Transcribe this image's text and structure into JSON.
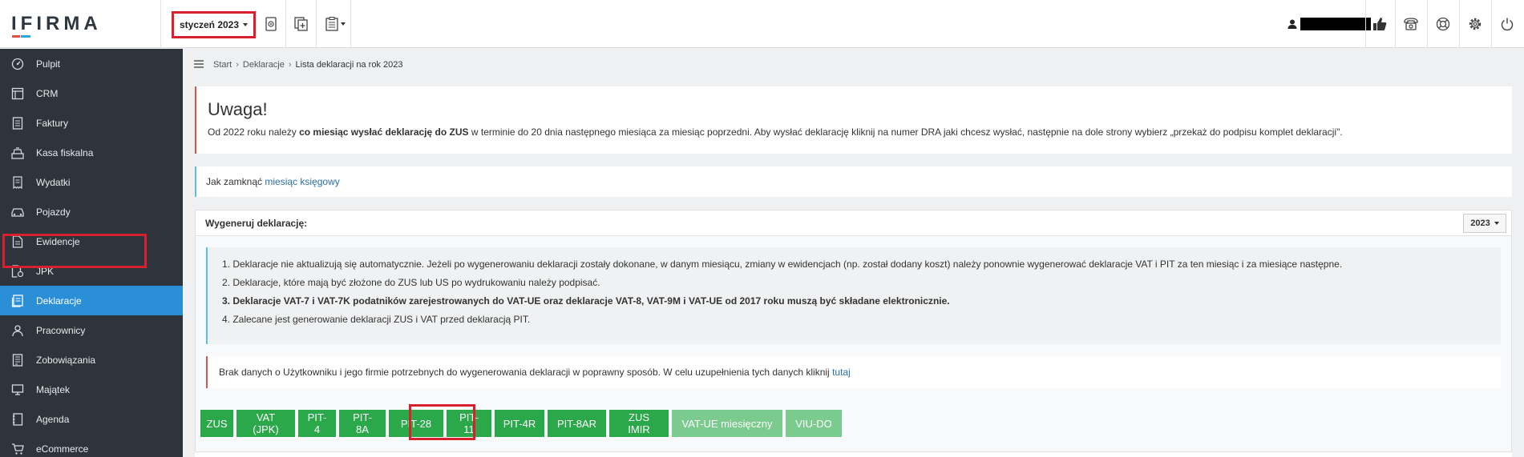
{
  "header": {
    "logo_text": "IFIRMA",
    "month_selector": "styczeń 2023",
    "icons": [
      "stamp-icon",
      "add-document-icon",
      "clipboard-menu-icon",
      "user-icon",
      "thumbs-up-icon",
      "phone-icon",
      "lifebuoy-icon",
      "settings-icon",
      "power-icon"
    ]
  },
  "sidebar": {
    "items": [
      {
        "label": "Pulpit",
        "icon": "dashboard-icon"
      },
      {
        "label": "CRM",
        "icon": "crm-icon"
      },
      {
        "label": "Faktury",
        "icon": "invoice-icon"
      },
      {
        "label": "Kasa fiskalna",
        "icon": "cash-register-icon"
      },
      {
        "label": "Wydatki",
        "icon": "expenses-icon"
      },
      {
        "label": "Pojazdy",
        "icon": "car-icon"
      },
      {
        "label": "Ewidencje",
        "icon": "records-icon"
      },
      {
        "label": "JPK",
        "icon": "jpk-icon"
      },
      {
        "label": "Deklaracje",
        "icon": "declarations-icon",
        "active": true
      },
      {
        "label": "Pracownicy",
        "icon": "employees-icon"
      },
      {
        "label": "Zobowiązania",
        "icon": "liabilities-icon"
      },
      {
        "label": "Majątek",
        "icon": "assets-icon"
      },
      {
        "label": "Agenda",
        "icon": "agenda-icon"
      },
      {
        "label": "eCommerce",
        "icon": "cart-icon"
      }
    ]
  },
  "breadcrumb": {
    "start": "Start",
    "section": "Deklaracje",
    "current": "Lista deklaracji na rok 2023"
  },
  "alert": {
    "title": "Uwaga!",
    "text_before": "Od 2022 roku należy ",
    "text_bold": "co miesiąc wysłać deklarację do ZUS",
    "text_after": " w terminie do 20 dnia następnego miesiąca za miesiąc poprzedni. Aby wysłać deklarację kliknij na numer DRA jaki chcesz wysłać, następnie na dole strony wybierz „przekaż do podpisu komplet deklaracji\"."
  },
  "close_month": {
    "text": "Jak zamknąć ",
    "link": "miesiąc księgowy"
  },
  "generate": {
    "title": "Wygeneruj deklarację:",
    "year": "2023",
    "notes": [
      "1. Deklaracje nie aktualizują się automatycznie. Jeżeli po wygenerowaniu deklaracji zostały dokonane, w danym miesiącu, zmiany w ewidencjach (np. został dodany koszt) należy ponownie wygenerować deklaracje VAT i PIT za ten miesiąc i za miesiące następne.",
      "2. Deklaracje, które mają być złożone do ZUS lub US po wydrukowaniu należy podpisać.",
      "3. Deklaracje VAT-7 i VAT-7K podatników zarejestrowanych do VAT-UE oraz deklaracje VAT-8, VAT-9M i VAT-UE od 2017 roku muszą być składane elektronicznie.",
      "4. Zalecane jest generowanie deklaracji ZUS i VAT przed deklaracją PIT."
    ],
    "warning_text": "Brak danych o Użytkowniku i jego firmie potrzebnych do wygenerowania deklaracji w poprawny sposób. W celu uzupełnienia tych danych kliknij ",
    "warning_link": "tutaj",
    "buttons": [
      {
        "label": "ZUS",
        "muted": false
      },
      {
        "label": "VAT (JPK)",
        "muted": false
      },
      {
        "label": "PIT-4",
        "muted": false
      },
      {
        "label": "PIT-8A",
        "muted": false
      },
      {
        "label": "PIT-28",
        "muted": false
      },
      {
        "label": "PIT-11",
        "muted": false
      },
      {
        "label": "PIT-4R",
        "muted": false
      },
      {
        "label": "PIT-8AR",
        "muted": false
      },
      {
        "label": "ZUS IMIR",
        "muted": false
      },
      {
        "label": "VAT-UE miesięczny",
        "muted": true
      },
      {
        "label": "VIU-DO",
        "muted": true
      }
    ]
  },
  "colors": {
    "sidebar_bg": "#2e343b",
    "active_item": "#2a8fd6",
    "button_green": "#2ba84a",
    "button_green_muted": "#7bcb8e",
    "highlight_red": "#d9202f"
  }
}
